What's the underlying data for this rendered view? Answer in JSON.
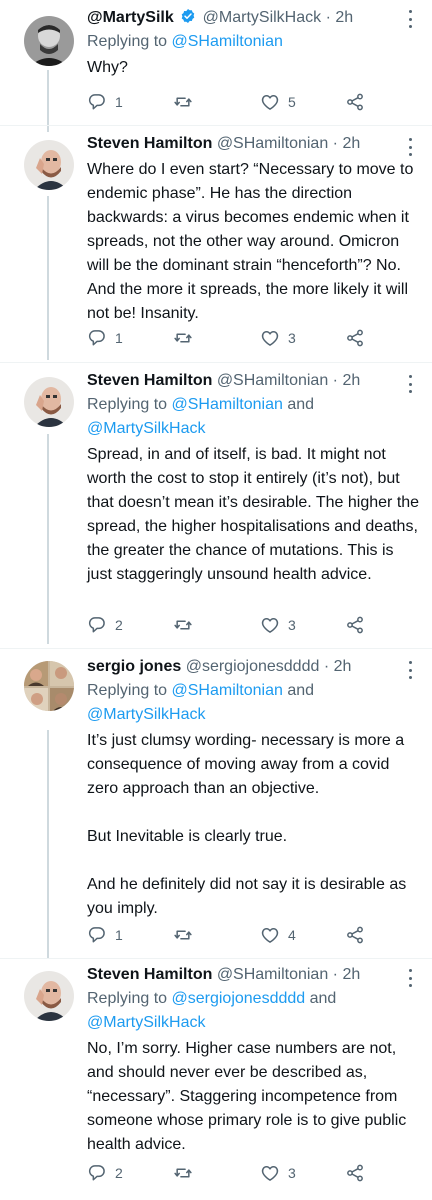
{
  "colors": {
    "text": "#0f1419",
    "secondary": "#536471",
    "link": "#1d9bf0",
    "line": "#cfd9de"
  },
  "icons": {
    "reply": "reply-icon",
    "retweet": "retweet-icon",
    "like": "heart-icon",
    "share": "share-icon",
    "more": "more-icon",
    "verified": "verified-badge-icon"
  },
  "tweets": [
    {
      "name": "@MartySilk",
      "handle": "@MartySilkHack",
      "time": "· 2h",
      "reply_prefix": "Replying to ",
      "reply_to_1": "@SHamiltonian",
      "reply_join": "",
      "reply_to_2": "",
      "text": [
        "Why?"
      ],
      "replies": "1",
      "retweets": "",
      "likes": "5"
    },
    {
      "name": "Steven Hamilton",
      "handle": "@SHamiltonian",
      "time": "· 2h",
      "text": [
        "Where do I even start? “Necessary to move to endemic phase”. He has the direction backwards: a virus becomes endemic when it spreads, not the other way around. Omicron will be the dominant strain “henceforth”? No. And the more it spreads, the more likely it will not be! Insanity."
      ],
      "replies": "1",
      "retweets": "",
      "likes": "3"
    },
    {
      "name": "Steven Hamilton",
      "handle": "@SHamiltonian",
      "time": "· 2h",
      "reply_prefix": "Replying to ",
      "reply_to_1": "@SHamiltonian",
      "reply_join": " and",
      "reply_to_2": "@MartySilkHack",
      "text": [
        "Spread, in and of itself, is bad. It might not worth the cost to stop it entirely (it’s not), but that doesn’t mean it’s desirable. The higher the spread, the higher hospitalisations and deaths, the greater the chance of mutations. This is just staggeringly unsound health advice."
      ],
      "replies": "2",
      "retweets": "",
      "likes": "3"
    },
    {
      "name": "sergio jones",
      "handle": "@sergiojonesdddd",
      "time": "· 2h",
      "reply_prefix": "Replying to ",
      "reply_to_1": "@SHamiltonian",
      "reply_join": " and",
      "reply_to_2": "@MartySilkHack",
      "text": [
        "It’s just clumsy wording- necessary is more a consequence of moving away from a covid zero approach than an objective.",
        "But Inevitable is clearly true.",
        "And he definitely did not say it is desirable as you imply."
      ],
      "replies": "1",
      "retweets": "",
      "likes": "4"
    },
    {
      "name": "Steven Hamilton",
      "handle": "@SHamiltonian",
      "time": "· 2h",
      "reply_prefix": "Replying to ",
      "reply_to_1": "@sergiojonesdddd",
      "reply_join": " and",
      "reply_to_2": "@MartySilkHack",
      "text": [
        "No, I’m sorry. Higher case numbers are not, and should never ever be described as, “necessary”. Staggering incompetence from someone whose primary role is to give public health advice."
      ],
      "replies": "2",
      "retweets": "",
      "likes": "3"
    }
  ]
}
